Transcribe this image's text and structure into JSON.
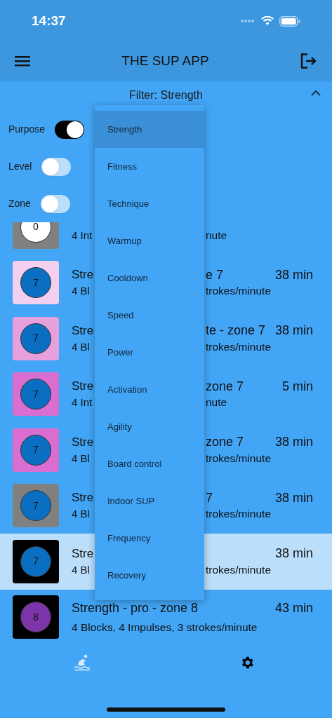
{
  "status_bar": {
    "time": "14:37"
  },
  "app_bar": {
    "title": "THE SUP APP"
  },
  "filter": {
    "label": "Filter: Strength",
    "expanded": true,
    "toggles": [
      {
        "label": "Purpose",
        "on": true
      },
      {
        "label": "Level",
        "on": false
      },
      {
        "label": "Zone",
        "on": false
      }
    ]
  },
  "dropdown": {
    "items": [
      {
        "label": "Strength",
        "selected": true
      },
      {
        "label": "Fitness",
        "selected": false
      },
      {
        "label": "Technique",
        "selected": false
      },
      {
        "label": "Warmup",
        "selected": false
      },
      {
        "label": "Cooldown",
        "selected": false
      },
      {
        "label": "Speed",
        "selected": false
      },
      {
        "label": "Power",
        "selected": false
      },
      {
        "label": "Activation",
        "selected": false
      },
      {
        "label": "Agility",
        "selected": false
      },
      {
        "label": "Board control",
        "selected": false
      },
      {
        "label": "Indoor SUP",
        "selected": false
      },
      {
        "label": "Frequency",
        "selected": false
      },
      {
        "label": "Recovery",
        "selected": false
      }
    ]
  },
  "workouts": [
    {
      "kind": "covered",
      "color": "#808080",
      "badge": {
        "label": "0",
        "color": "#ffffff"
      },
      "subtitle_start": "4 Int",
      "subtitle_end": "nute",
      "selected": false
    },
    {
      "kind": "covered",
      "color": "#f3d0ef",
      "badge": {
        "label": "7",
        "color": "#0a6fc0"
      },
      "title_start": "Stre",
      "title_end": "e 7",
      "duration": "38 min",
      "subtitle_start": "4 Bl",
      "subtitle_end": "trokes/minute",
      "selected": false
    },
    {
      "kind": "covered",
      "color": "#e6a0dc",
      "badge": {
        "label": "7",
        "color": "#0a6fc0"
      },
      "title_start": "Stre",
      "title_end": "te - zone 7",
      "duration": "38 min",
      "subtitle_start": "4 Bl",
      "subtitle_end": "trokes/minute",
      "selected": false
    },
    {
      "kind": "covered",
      "color": "#d96ed0",
      "badge": {
        "label": "7",
        "color": "#0a6fc0"
      },
      "title_start": "Stre",
      "title_end": "zone 7",
      "duration": "5 min",
      "subtitle_start": "4 Int",
      "subtitle_end": "nute",
      "selected": false
    },
    {
      "kind": "covered",
      "color": "#d96ed0",
      "badge": {
        "label": "7",
        "color": "#0a6fc0"
      },
      "title_start": "Stre",
      "title_end": "zone 7",
      "duration": "38 min",
      "subtitle_start": "4 Bl",
      "subtitle_end": "trokes/minute",
      "selected": false
    },
    {
      "kind": "covered",
      "color": "#808080",
      "badge": {
        "label": "7",
        "color": "#0a6fc0"
      },
      "title_start": "Stre",
      "title_end": "7",
      "duration": "38 min",
      "subtitle_start": "4 Bl",
      "subtitle_end": "trokes/minute",
      "selected": false
    },
    {
      "kind": "covered",
      "color": "#000000",
      "badge": {
        "label": "7",
        "color": "#0a6fc0"
      },
      "title_start": "Stre",
      "duration": "38 min",
      "subtitle_start": "4 Bl",
      "subtitle_end": "trokes/minute",
      "selected": true
    },
    {
      "kind": "full",
      "color": "#000000",
      "badge": {
        "label": "8",
        "color": "#7b35a8"
      },
      "title": "Strength - pro - zone 8",
      "duration": "43 min",
      "subtitle": "4 Blocks, 4 Impulses, 3 strokes/minute",
      "selected": false
    }
  ],
  "bottom_nav": [
    {
      "kind": "surf",
      "selected": true
    },
    {
      "kind": "settings",
      "selected": false
    }
  ]
}
